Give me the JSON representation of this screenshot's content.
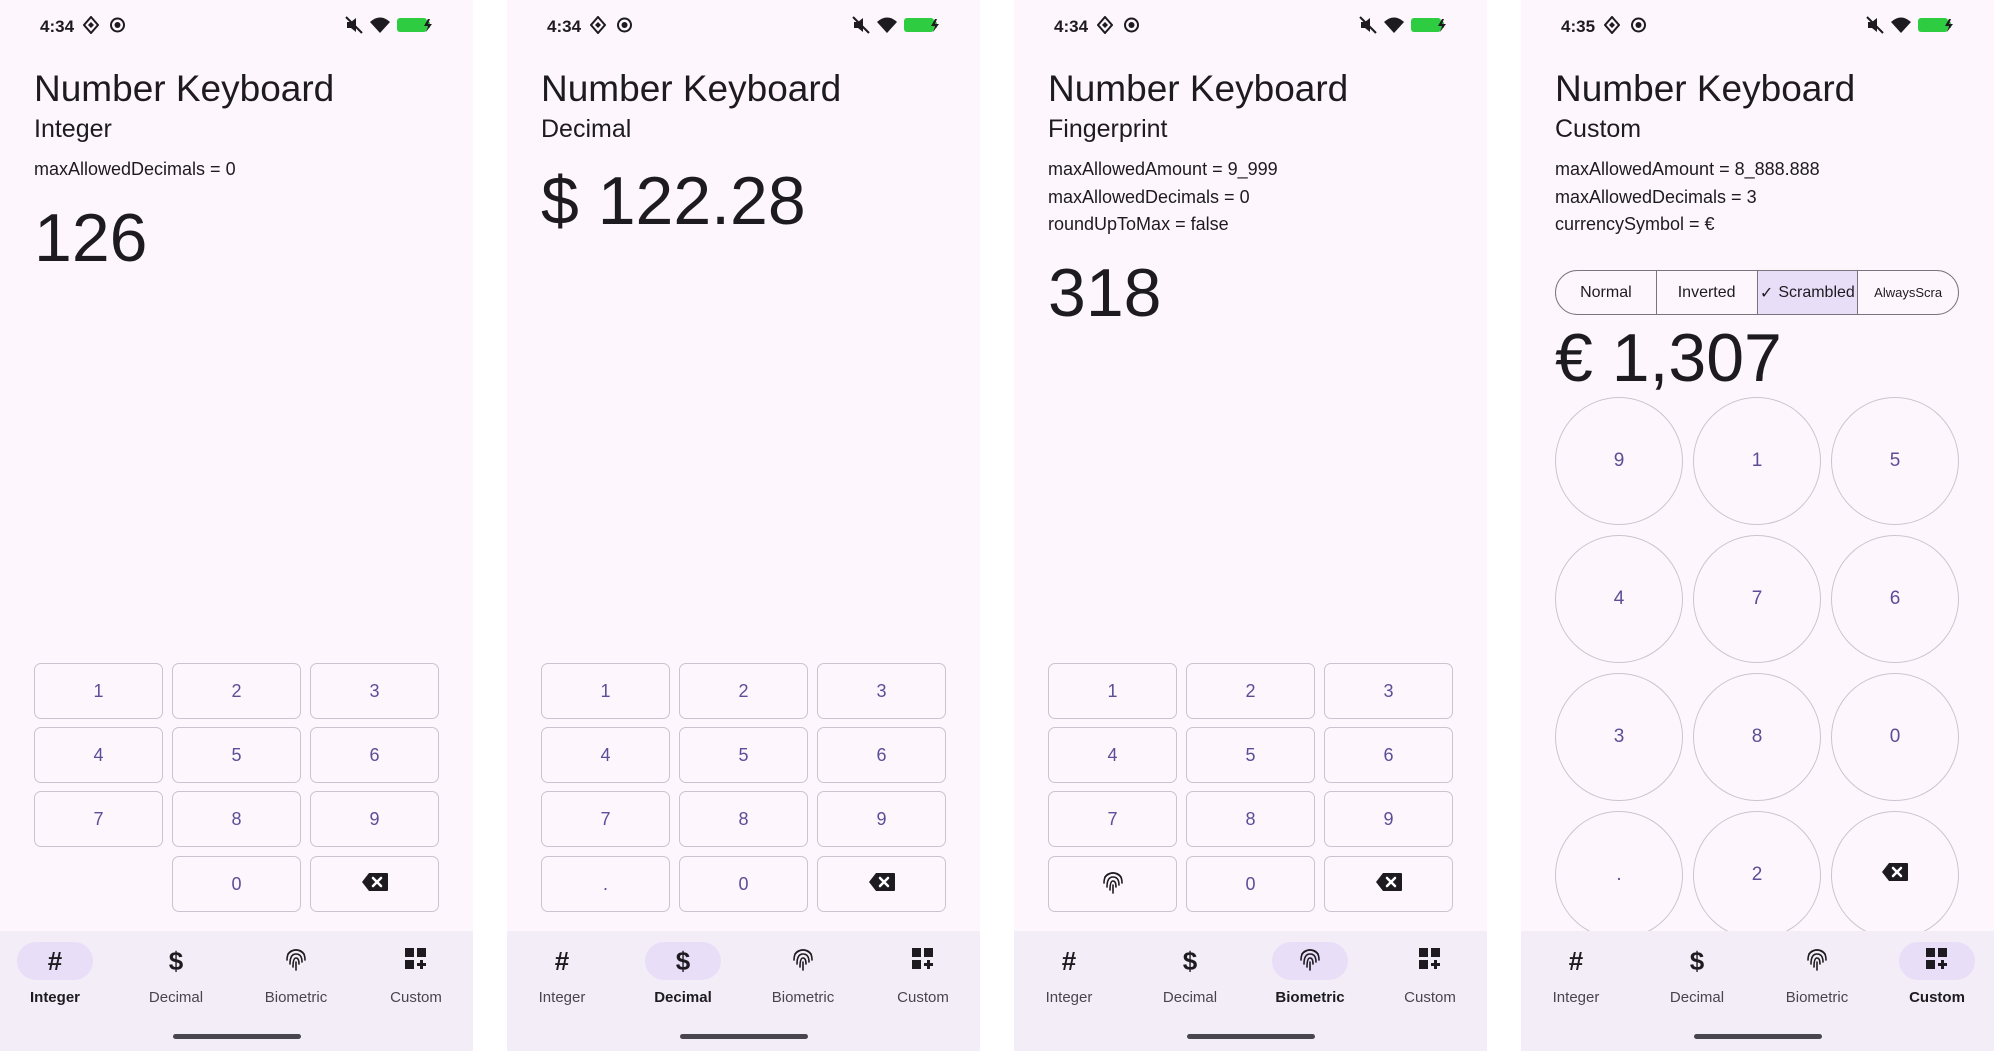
{
  "colors": {
    "background": "#fdf7fd",
    "key_text": "#5b4e96",
    "nav_bg": "#f3edf7",
    "selected": "#e8def8",
    "battery": "#2ecc40"
  },
  "nav_labels": [
    "Integer",
    "Decimal",
    "Biometric",
    "Custom"
  ],
  "nav_icons": [
    "hash-icon",
    "dollar-icon",
    "fingerprint-icon",
    "dashboard-add-icon"
  ],
  "screens": [
    {
      "time": "4:34",
      "title": "Number Keyboard",
      "subtitle": "Integer",
      "params": [
        "maxAllowedDecimals = 0"
      ],
      "amount": "126",
      "keys": [
        "1",
        "2",
        "3",
        "4",
        "5",
        "6",
        "7",
        "8",
        "9",
        "",
        "0",
        "backspace-icon"
      ],
      "active_tab": 0
    },
    {
      "time": "4:34",
      "title": "Number Keyboard",
      "subtitle": "Decimal",
      "params": [],
      "amount": "$ 122.28",
      "keys": [
        "1",
        "2",
        "3",
        "4",
        "5",
        "6",
        "7",
        "8",
        "9",
        ".",
        "0",
        "backspace-icon"
      ],
      "active_tab": 1
    },
    {
      "time": "4:34",
      "title": "Number Keyboard",
      "subtitle": "Fingerprint",
      "params": [
        "maxAllowedAmount = 9_999",
        "maxAllowedDecimals = 0",
        "roundUpToMax = false"
      ],
      "amount": "318",
      "keys": [
        "1",
        "2",
        "3",
        "4",
        "5",
        "6",
        "7",
        "8",
        "9",
        "fingerprint-icon",
        "0",
        "backspace-icon"
      ],
      "active_tab": 2
    },
    {
      "time": "4:35",
      "title": "Number Keyboard",
      "subtitle": "Custom",
      "params": [
        "maxAllowedAmount = 8_888.888",
        "maxAllowedDecimals = 3",
        "currencySymbol = €"
      ],
      "segments": [
        "Normal",
        "Inverted",
        "Scrambled",
        "AlwaysScra"
      ],
      "selected_segment": "Scrambled",
      "amount": "€ 1,307",
      "keys": [
        "9",
        "1",
        "5",
        "4",
        "7",
        "6",
        "3",
        "8",
        "0",
        ".",
        "2",
        "backspace-icon"
      ],
      "active_tab": 3
    }
  ]
}
